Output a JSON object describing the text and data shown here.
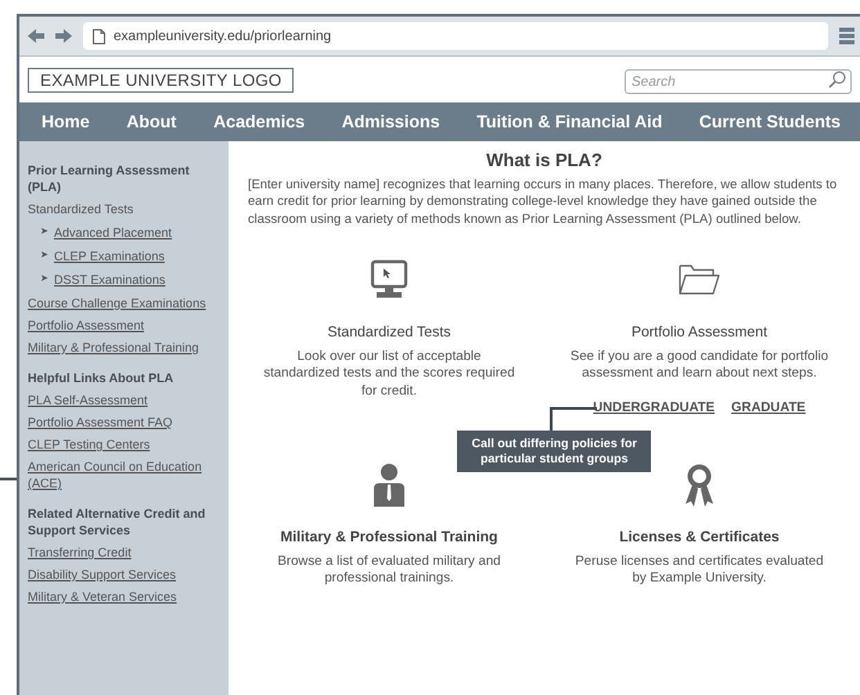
{
  "browser": {
    "url": "exampleuniversity.edu/priorlearning"
  },
  "header": {
    "logo": "EXAMPLE UNIVERSITY LOGO",
    "search": {
      "placeholder": "Search"
    }
  },
  "nav": [
    "Home",
    "About",
    "Academics",
    "Admissions",
    "Tuition & Financial Aid",
    "Current Students"
  ],
  "sidebar": [
    {
      "kind": "heading",
      "text": "Prior Learning Assessment (PLA)"
    },
    {
      "kind": "label",
      "text": "Standardized Tests"
    },
    {
      "kind": "sublink",
      "marker": "➤",
      "text": "Advanced Placement"
    },
    {
      "kind": "sublink",
      "marker": "➤",
      "text": "CLEP Examinations"
    },
    {
      "kind": "sublink",
      "marker": "➤",
      "text": "DSST Examinations"
    },
    {
      "kind": "link",
      "text": "Course Challenge Examinations"
    },
    {
      "kind": "link",
      "text": "Portfolio Assessment"
    },
    {
      "kind": "link",
      "text": "Military & Professional Training"
    },
    {
      "kind": "heading",
      "text": "Helpful Links About PLA"
    },
    {
      "kind": "link",
      "text": "PLA Self-Assessment"
    },
    {
      "kind": "link",
      "text": "Portfolio Assessment FAQ"
    },
    {
      "kind": "link",
      "text": "CLEP Testing Centers"
    },
    {
      "kind": "link",
      "text": "American Council on Education (ACE)"
    },
    {
      "kind": "heading",
      "text": "Related Alternative Credit and Support Services"
    },
    {
      "kind": "link",
      "text": "Transferring Credit"
    },
    {
      "kind": "link",
      "text": "Disability Support Services"
    },
    {
      "kind": "link",
      "text": "Military & Veteran Services"
    }
  ],
  "main": {
    "title": "What is PLA?",
    "intro": "[Enter university name] recognizes that learning occurs in many places. Therefore, we allow students to earn credit for prior learning by demonstrating college-level knowledge they have gained outside the classroom using a variety of methods known as Prior Learning Assessment (PLA) outlined below.",
    "cards": [
      {
        "title": "Standardized Tests",
        "text": "Look over our list of acceptable standardized tests and the scores required for credit."
      },
      {
        "title": "Portfolio Assessment",
        "text": "See if you are a good candidate for portfolio assessment and learn about next steps.",
        "links": [
          "UNDERGRADUATE",
          "GRADUATE"
        ]
      },
      {
        "title": "Military & Professional Training",
        "text": "Browse a list of evaluated military and professional trainings."
      },
      {
        "title": "Licenses & Certificates",
        "text": "Peruse licenses and certificates evaluated by Example University."
      }
    ],
    "callout": "Call out differing policies for particular student groups"
  }
}
